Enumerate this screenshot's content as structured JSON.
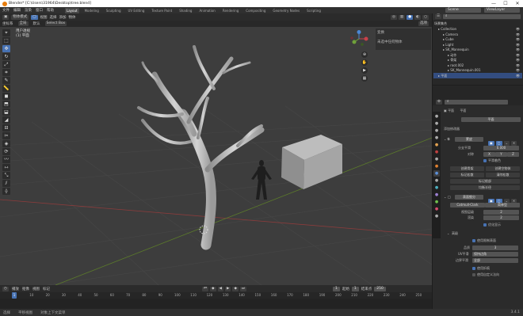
{
  "titlebar": {
    "title": "Blender* [C:\\Users\\31964\\Desktop\\tree.blend]",
    "minimize": "—",
    "maximize": "☐",
    "close": "✕"
  },
  "menu": [
    "文件",
    "编辑",
    "渲染",
    "窗口",
    "帮助"
  ],
  "workspaces": [
    "Layout",
    "Modeling",
    "Sculpting",
    "UV Editing",
    "Texture Paint",
    "Shading",
    "Animation",
    "Rendering",
    "Compositing",
    "Geometry Nodes",
    "Scripting"
  ],
  "scene": {
    "name": "Scene",
    "view_layer": "ViewLayer"
  },
  "header": {
    "mode": "物体模式",
    "view": "视图",
    "select": "选择",
    "add": "添加",
    "object": "物体",
    "orientation": "全局",
    "drag": "Select Box"
  },
  "header3": {
    "coord": "坐标系",
    "default": "默认",
    "options": "选项"
  },
  "viewport": {
    "persp": "用户透视",
    "collection": "(1) 平面"
  },
  "npanel": {
    "tab": "变换",
    "hint": "未选中任何物体"
  },
  "tools": [
    "cursor-icon",
    "select-icon",
    "move-icon",
    "rotate-icon",
    "scale-icon",
    "transform-icon",
    "annotate-icon",
    "measure-icon",
    "add-cube-icon",
    "extrude-icon",
    "inset-icon",
    "bevel-icon",
    "loopcut-icon",
    "knife-icon",
    "polybuild-icon",
    "spin-icon",
    "smooth-icon",
    "edge-slide-icon",
    "shrink-icon",
    "shear-icon",
    "rip-icon"
  ],
  "outliner": {
    "title": "场景集合",
    "rows": [
      {
        "label": "Collection",
        "indent": 1
      },
      {
        "label": "Camera",
        "indent": 2
      },
      {
        "label": "Cube",
        "indent": 2
      },
      {
        "label": "Light",
        "indent": 2
      },
      {
        "label": "SK_Mannequin",
        "indent": 2
      },
      {
        "label": "动作",
        "indent": 3
      },
      {
        "label": "骨架",
        "indent": 3
      },
      {
        "label": "root.002",
        "indent": 3
      },
      {
        "label": "SK_Mannequin.001",
        "indent": 3
      },
      {
        "label": "平面",
        "indent": 1
      }
    ]
  },
  "props": {
    "object": "平面",
    "modifier_name": "平面",
    "add_modifier": "添加修改器",
    "subsurf": "蒙皮",
    "res_label": "分支平滑",
    "res_value": "0.000",
    "symmetry": "对称",
    "sym_x": "X",
    "sym_y": "Y",
    "sym_z": "Z",
    "smooth": "平滑着色",
    "create_armature": "创建骨架",
    "create_empty": "创建空物体",
    "mark_loose": "标记松散",
    "clear_loose": "清除松散",
    "mark_root": "标记根部",
    "equalize": "均衡半径",
    "subdiv": "表面细分",
    "catmull": "Catmull-Clark",
    "simple": "简单型",
    "levels_viewport": "视图层级",
    "render_levels": "渲染",
    "optimal": "优化显示",
    "lv_val": "2",
    "rd_val": "2",
    "advanced": "高级",
    "use_limit": "使用限制表面",
    "quality": "品质",
    "quality_val": "3",
    "uv_smooth": "UV平滑",
    "uv_val": "保持边角",
    "boundary": "边界平滑",
    "boundary_val": "全部",
    "creases": "使用折痕",
    "custom_normals": "使用自定义法向"
  },
  "timeline": {
    "play": "播放",
    "keying": "抠像",
    "view": "视图",
    "markers": "标记",
    "frame": "1",
    "start": "起始",
    "start_val": "1",
    "end": "结束点",
    "end_val": "250"
  },
  "ruler": [
    "0",
    "10",
    "20",
    "30",
    "40",
    "50",
    "60",
    "70",
    "80",
    "90",
    "100",
    "110",
    "120",
    "130",
    "140",
    "150",
    "160",
    "170",
    "180",
    "190",
    "200",
    "210",
    "220",
    "230",
    "240",
    "250"
  ],
  "statusbar": [
    "选择",
    "平移视图",
    "对象上下文菜单",
    "3.4.1"
  ]
}
